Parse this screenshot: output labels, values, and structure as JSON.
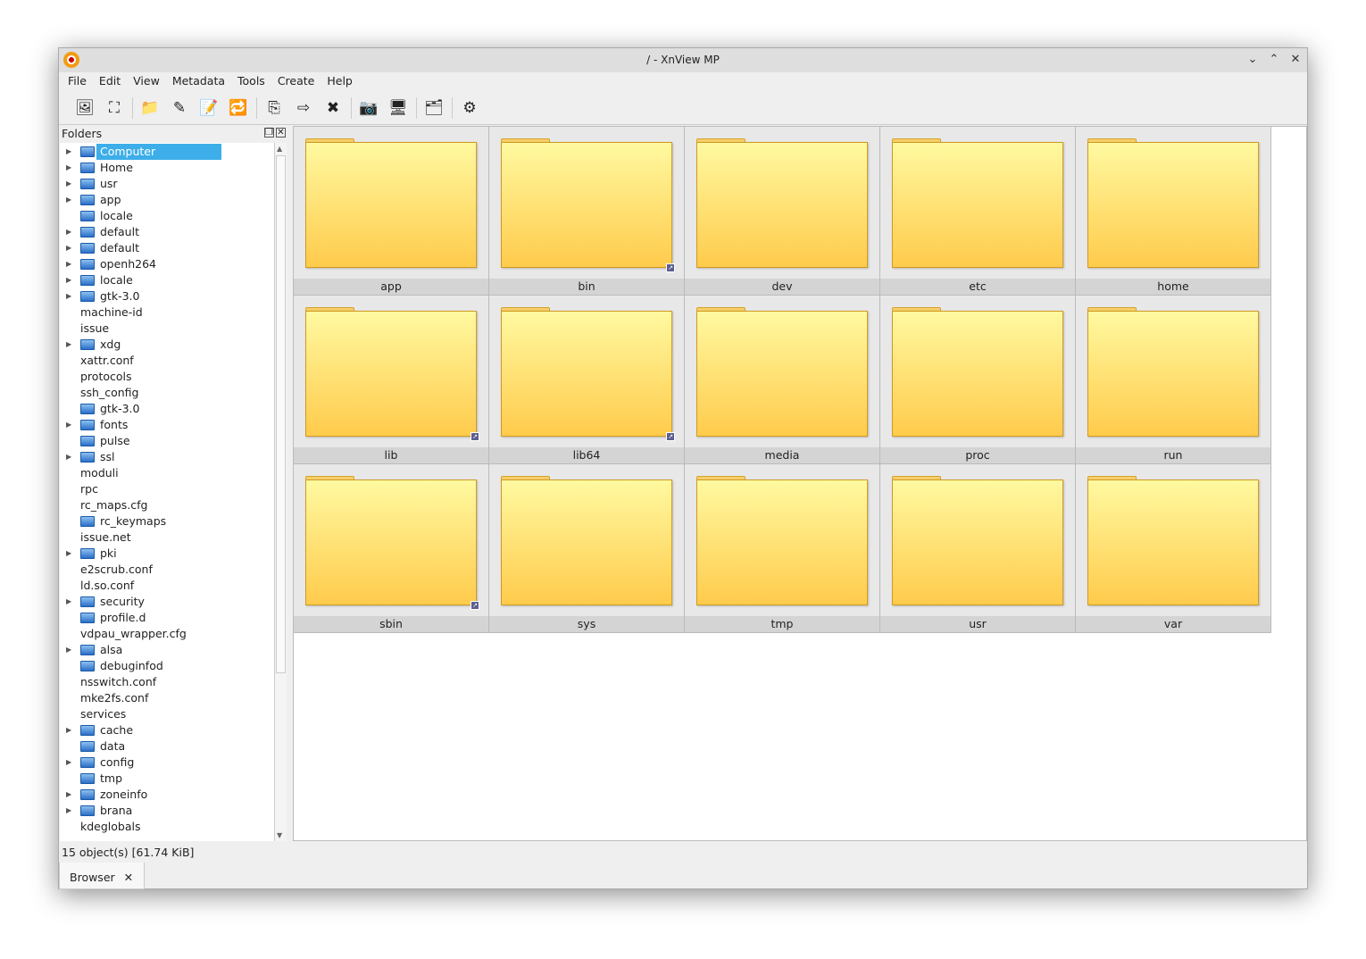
{
  "window": {
    "title": "/ - XnView MP",
    "minimize": "⌄",
    "maximize": "⌃",
    "close": "✕"
  },
  "menu": [
    "File",
    "Edit",
    "View",
    "Metadata",
    "Tools",
    "Create",
    "Help"
  ],
  "toolbar": [
    {
      "icon": "image-viewer-icon",
      "g": "🖼"
    },
    {
      "icon": "fullscreen-icon",
      "g": "⛶"
    },
    "sep",
    {
      "icon": "new-folder-icon",
      "g": "📁"
    },
    {
      "icon": "rename-icon",
      "g": "✎"
    },
    {
      "icon": "batch-rename-icon",
      "g": "📝"
    },
    {
      "icon": "convert-icon",
      "g": "🔁"
    },
    "sep",
    {
      "icon": "copy-to-icon",
      "g": "⎘"
    },
    {
      "icon": "move-to-icon",
      "g": "⇨"
    },
    {
      "icon": "delete-icon",
      "g": "✖"
    },
    "sep",
    {
      "icon": "capture-icon",
      "g": "📷"
    },
    {
      "icon": "slideshow-icon",
      "g": "🖥"
    },
    "sep",
    {
      "icon": "folder-tree-icon",
      "g": "🗂"
    },
    "sep",
    {
      "icon": "settings-gear-icon",
      "g": "⚙"
    }
  ],
  "folders_panel": {
    "title": "Folders"
  },
  "tree": [
    {
      "label": "Computer",
      "arrow": true,
      "folder": true,
      "selected": true
    },
    {
      "label": "Home",
      "arrow": true,
      "folder": true
    },
    {
      "label": "usr",
      "arrow": true,
      "folder": true
    },
    {
      "label": "app",
      "arrow": true,
      "folder": true
    },
    {
      "label": "locale",
      "arrow": false,
      "folder": true
    },
    {
      "label": "default",
      "arrow": true,
      "folder": true
    },
    {
      "label": "default",
      "arrow": true,
      "folder": true
    },
    {
      "label": "openh264",
      "arrow": true,
      "folder": true
    },
    {
      "label": "locale",
      "arrow": true,
      "folder": true
    },
    {
      "label": "gtk-3.0",
      "arrow": true,
      "folder": true
    },
    {
      "label": "machine-id",
      "arrow": false,
      "folder": false
    },
    {
      "label": "issue",
      "arrow": false,
      "folder": false
    },
    {
      "label": "xdg",
      "arrow": true,
      "folder": true
    },
    {
      "label": "xattr.conf",
      "arrow": false,
      "folder": false
    },
    {
      "label": "protocols",
      "arrow": false,
      "folder": false
    },
    {
      "label": "ssh_config",
      "arrow": false,
      "folder": false
    },
    {
      "label": "gtk-3.0",
      "arrow": false,
      "folder": true
    },
    {
      "label": "fonts",
      "arrow": true,
      "folder": true
    },
    {
      "label": "pulse",
      "arrow": false,
      "folder": true
    },
    {
      "label": "ssl",
      "arrow": true,
      "folder": true
    },
    {
      "label": "moduli",
      "arrow": false,
      "folder": false
    },
    {
      "label": "rpc",
      "arrow": false,
      "folder": false
    },
    {
      "label": "rc_maps.cfg",
      "arrow": false,
      "folder": false
    },
    {
      "label": "rc_keymaps",
      "arrow": false,
      "folder": true
    },
    {
      "label": "issue.net",
      "arrow": false,
      "folder": false
    },
    {
      "label": "pki",
      "arrow": true,
      "folder": true
    },
    {
      "label": "e2scrub.conf",
      "arrow": false,
      "folder": false
    },
    {
      "label": "ld.so.conf",
      "arrow": false,
      "folder": false
    },
    {
      "label": "security",
      "arrow": true,
      "folder": true
    },
    {
      "label": "profile.d",
      "arrow": false,
      "folder": true
    },
    {
      "label": "vdpau_wrapper.cfg",
      "arrow": false,
      "folder": false
    },
    {
      "label": "alsa",
      "arrow": true,
      "folder": true
    },
    {
      "label": "debuginfod",
      "arrow": false,
      "folder": true
    },
    {
      "label": "nsswitch.conf",
      "arrow": false,
      "folder": false
    },
    {
      "label": "mke2fs.conf",
      "arrow": false,
      "folder": false
    },
    {
      "label": "services",
      "arrow": false,
      "folder": false
    },
    {
      "label": "cache",
      "arrow": true,
      "folder": true
    },
    {
      "label": "data",
      "arrow": false,
      "folder": true
    },
    {
      "label": "config",
      "arrow": true,
      "folder": true
    },
    {
      "label": "tmp",
      "arrow": false,
      "folder": true
    },
    {
      "label": "zoneinfo",
      "arrow": true,
      "folder": true
    },
    {
      "label": "brana",
      "arrow": true,
      "folder": true
    },
    {
      "label": "kdeglobals",
      "arrow": false,
      "folder": false
    }
  ],
  "grid": [
    {
      "name": "app",
      "link": false
    },
    {
      "name": "bin",
      "link": true
    },
    {
      "name": "dev",
      "link": false
    },
    {
      "name": "etc",
      "link": false
    },
    {
      "name": "home",
      "link": false
    },
    {
      "name": "lib",
      "link": true
    },
    {
      "name": "lib64",
      "link": true
    },
    {
      "name": "media",
      "link": false
    },
    {
      "name": "proc",
      "link": false
    },
    {
      "name": "run",
      "link": false
    },
    {
      "name": "sbin",
      "link": true
    },
    {
      "name": "sys",
      "link": false
    },
    {
      "name": "tmp",
      "link": false
    },
    {
      "name": "usr",
      "link": false
    },
    {
      "name": "var",
      "link": false
    }
  ],
  "status": "15 object(s) [61.74 KiB]",
  "tabs": [
    {
      "label": "Browser",
      "close": "✕"
    }
  ]
}
